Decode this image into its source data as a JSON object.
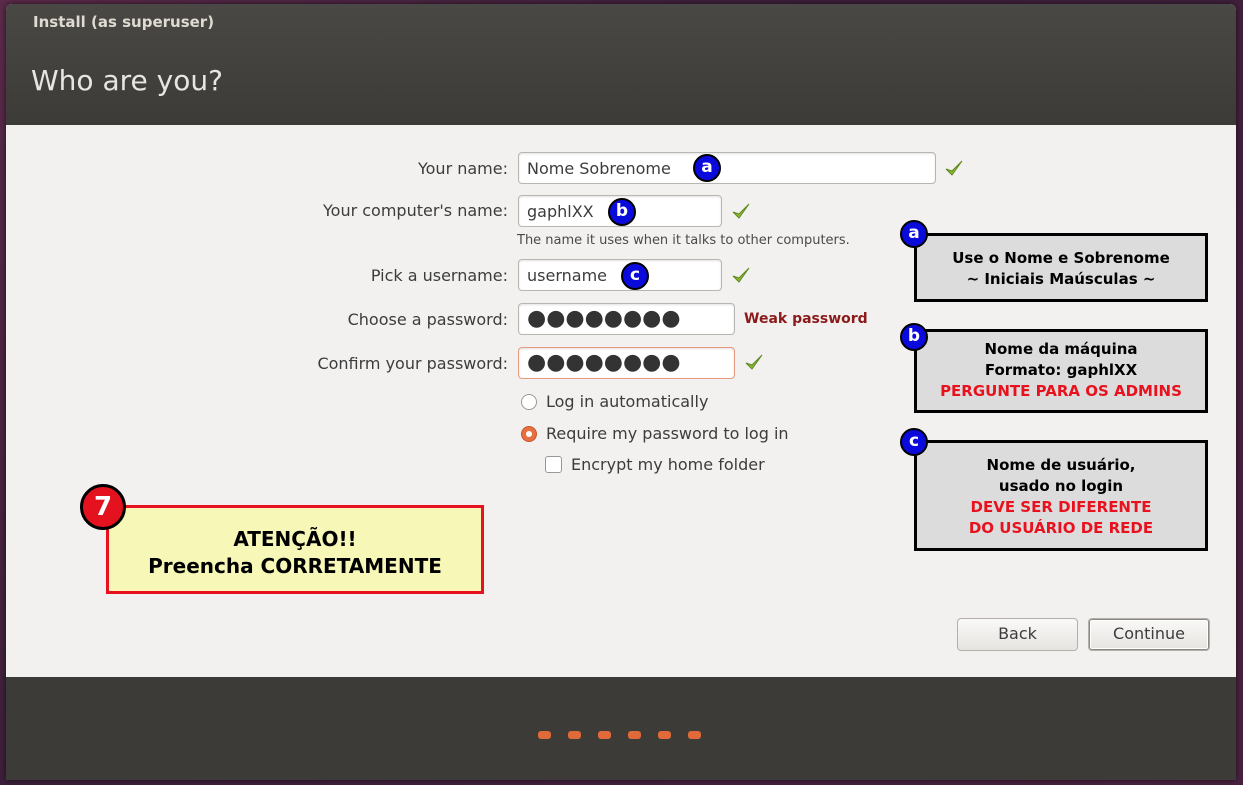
{
  "window": {
    "title": "Install (as superuser)"
  },
  "page": {
    "title": "Who are you?"
  },
  "form": {
    "name_label": "Your name:",
    "name_value": "Nome Sobrenome",
    "computer_label": "Your computer's name:",
    "computer_value": "gaphlXX",
    "computer_hint": "The name it uses when it talks to other computers.",
    "username_label": "Pick a username:",
    "username_value": "username",
    "password_label": "Choose a password:",
    "password_value": "●●●●●●●●",
    "password_strength": "Weak password",
    "confirm_label": "Confirm your password:",
    "confirm_value": "●●●●●●●●",
    "login_auto_label": "Log in automatically",
    "login_password_label": "Require my password to log in",
    "encrypt_label": "Encrypt my home folder",
    "login_mode_selected": "Require my password to log in",
    "encrypt_checked": false
  },
  "badges": {
    "a": "a",
    "b": "b",
    "c": "c",
    "seven": "7"
  },
  "notes": {
    "a": {
      "line1": "Use o Nome e Sobrenome",
      "line2": "~ Iniciais Maúsculas ~"
    },
    "b": {
      "line1": "Nome da máquina",
      "line2": "Formato: gaphlXX",
      "line3": "PERGUNTE PARA OS ADMINS"
    },
    "c": {
      "line1": "Nome de usuário,",
      "line2": "usado no login",
      "line3": "DEVE SER DIFERENTE",
      "line4": "DO USUÁRIO DE REDE"
    }
  },
  "warning": {
    "line1": "ATENÇÃO!!",
    "line2": "Preencha CORRETAMENTE"
  },
  "buttons": {
    "back": "Back",
    "continue": "Continue"
  },
  "progress": {
    "steps": 6
  },
  "colors": {
    "accent": "#e6703f",
    "badge_blue": "#0a0adc",
    "alert_red": "#e8121e",
    "header_bg": "#3c3b37",
    "check_green": "#8ab833"
  }
}
